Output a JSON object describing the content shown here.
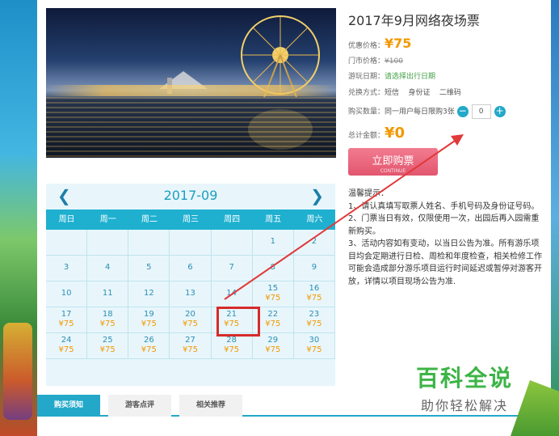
{
  "product": {
    "title": "2017年9月网络夜场票",
    "price_label": "优惠价格：",
    "price_now": "¥75",
    "market_label": "门市价格：",
    "price_old": "¥100",
    "date_label": "游玩日期：",
    "date_hint": "请选择出行日期",
    "exchange_label": "兑换方式：",
    "exchange_methods": "短信    身份证    二维码",
    "qty_label": "购买数量：",
    "qty_rule": "同一用户每日限购3张",
    "qty_value": "0",
    "minus": "−",
    "plus": "+",
    "total_label": "总计金额：",
    "total_value": "¥0",
    "buy_label": "立即购票",
    "buy_sub": "CONTINUE"
  },
  "tips": {
    "heading": "温馨提示：",
    "line1": "1、请认真填写取票人姓名、手机号码及身份证号码。",
    "line2": "2、门票当日有效，仅限使用一次，出园后再入园需重新购买。",
    "line3": "3、活动内容如有变动，以当日公告为准。所有游乐项目均会定期进行日检、周检和年度检查，相关检修工作可能会造成部分游乐项目运行时间延迟或暂停对游客开放，详情以项目现场公告为准."
  },
  "calendar": {
    "month": "2017-09",
    "prev_icon": "chevron-left-icon",
    "next_icon": "chevron-right-icon",
    "weekdays": [
      "周日",
      "周一",
      "周二",
      "周三",
      "周四",
      "周五",
      "周六"
    ],
    "weeks": [
      [
        {
          "d": "",
          "p": ""
        },
        {
          "d": "",
          "p": ""
        },
        {
          "d": "",
          "p": ""
        },
        {
          "d": "",
          "p": ""
        },
        {
          "d": "",
          "p": ""
        },
        {
          "d": "1",
          "p": ""
        },
        {
          "d": "2",
          "p": ""
        }
      ],
      [
        {
          "d": "3",
          "p": ""
        },
        {
          "d": "4",
          "p": ""
        },
        {
          "d": "5",
          "p": ""
        },
        {
          "d": "6",
          "p": ""
        },
        {
          "d": "7",
          "p": ""
        },
        {
          "d": "8",
          "p": ""
        },
        {
          "d": "9",
          "p": ""
        }
      ],
      [
        {
          "d": "10",
          "p": ""
        },
        {
          "d": "11",
          "p": ""
        },
        {
          "d": "12",
          "p": ""
        },
        {
          "d": "13",
          "p": ""
        },
        {
          "d": "14",
          "p": ""
        },
        {
          "d": "15",
          "p": "¥75"
        },
        {
          "d": "16",
          "p": "¥75"
        }
      ],
      [
        {
          "d": "17",
          "p": "¥75"
        },
        {
          "d": "18",
          "p": "¥75"
        },
        {
          "d": "19",
          "p": "¥75"
        },
        {
          "d": "20",
          "p": "¥75"
        },
        {
          "d": "21",
          "p": "¥75"
        },
        {
          "d": "22",
          "p": "¥75"
        },
        {
          "d": "23",
          "p": "¥75"
        }
      ],
      [
        {
          "d": "24",
          "p": "¥75"
        },
        {
          "d": "25",
          "p": "¥75"
        },
        {
          "d": "26",
          "p": "¥75"
        },
        {
          "d": "27",
          "p": "¥75"
        },
        {
          "d": "28",
          "p": "¥75"
        },
        {
          "d": "29",
          "p": "¥75"
        },
        {
          "d": "30",
          "p": "¥75"
        }
      ]
    ],
    "selected_day": "21"
  },
  "tabs": [
    "购买须知",
    "游客点评",
    "相关推荐"
  ],
  "watermark": {
    "big": "百科全说",
    "small": "助你轻松解决"
  },
  "colors": {
    "accent": "#23a8c9",
    "price": "#f39800",
    "buy": "#e2566f",
    "highlight": "#d62b2b"
  }
}
